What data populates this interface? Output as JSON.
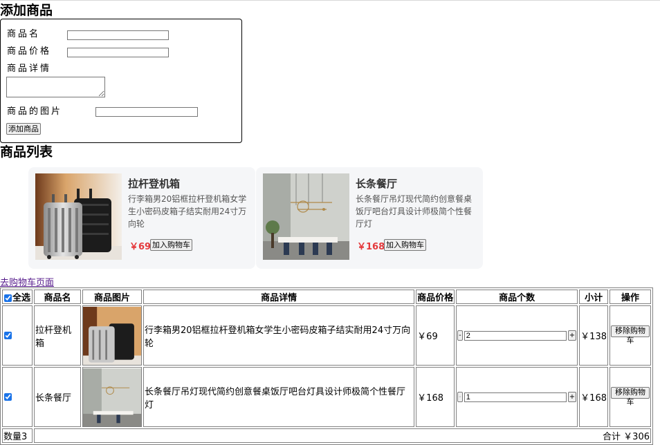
{
  "form": {
    "heading": "添加商品",
    "name_label": "商品名",
    "price_label": "商品价格",
    "detail_label": "商品详情",
    "image_label": "商品的图片",
    "name_value": "",
    "price_value": "",
    "detail_value": "",
    "image_value": "",
    "submit_label": "添加商品"
  },
  "list": {
    "heading": "商品列表",
    "products": [
      {
        "title": "拉杆登机箱",
        "desc": "行李箱男20铝框拉杆登机箱女学生小密码皮箱子结实耐用24寸万向轮",
        "price": "￥69",
        "button": "加入购物车",
        "image": "luggage-photo"
      },
      {
        "title": "长条餐厅",
        "desc": "长条餐厅吊灯现代简约创意餐桌饭厅吧台灯具设计师极简个性餐厅灯",
        "price": "￥168",
        "button": "加入购物车",
        "image": "dining-lamp-photo"
      }
    ]
  },
  "cart_link": "去购物车页面",
  "cart": {
    "headers": {
      "select_all": "全选",
      "name": "商品名",
      "image": "商品图片",
      "detail": "商品详情",
      "price": "商品价格",
      "count": "商品个数",
      "subtotal": "小计",
      "action": "操作"
    },
    "rows": [
      {
        "checked": true,
        "name": "拉杆登机箱",
        "detail": "行李箱男20铝框拉杆登机箱女学生小密码皮箱子结实耐用24寸万向轮",
        "price": "￥69",
        "minus": "-",
        "qty": "2",
        "plus": "+",
        "subtotal": "￥138",
        "remove": "移除购物车"
      },
      {
        "checked": true,
        "name": "长条餐厅",
        "detail": "长条餐厅吊灯现代简约创意餐桌饭厅吧台灯具设计师极简个性餐厅灯",
        "price": "￥168",
        "minus": "-",
        "qty": "1",
        "plus": "+",
        "subtotal": "￥168",
        "remove": "移除购物车"
      }
    ],
    "footer": {
      "count": "数量3",
      "total": "合计 ￥306"
    }
  },
  "colors": {
    "price_red": "#e4393c",
    "card_bg": "#f5f6f8",
    "link_visited": "#551a8b",
    "checkbox_accent": "#1a73e8"
  }
}
